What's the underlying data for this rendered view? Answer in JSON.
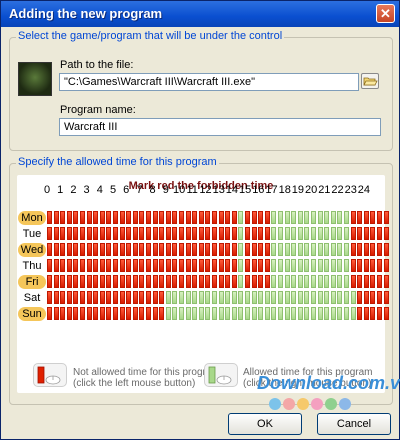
{
  "window": {
    "title": "Adding the new program",
    "close_glyph": "✕"
  },
  "group1": {
    "label": "Select the game/program that will be under the control",
    "path_label": "Path to the file:",
    "path_value": "\"C:\\Games\\Warcraft III\\Warcraft III.exe\"",
    "name_label": "Program name:",
    "name_value": "Warcraft III"
  },
  "group2": {
    "label": "Specify the allowed time for this program"
  },
  "grid": {
    "title": "Mark red the forbidden time",
    "hours": [
      "0",
      "1",
      "2",
      "3",
      "4",
      "5",
      "6",
      "7",
      "8",
      "9",
      "10",
      "11",
      "12",
      "13",
      "14",
      "15",
      "16",
      "17",
      "18",
      "19",
      "20",
      "21",
      "22",
      "23",
      "24"
    ],
    "days": [
      "Mon",
      "Tue",
      "Wed",
      "Thu",
      "Fri",
      "Sat",
      "Sun"
    ],
    "highlighted_days": [
      "Mon",
      "Wed",
      "Fri",
      "Sun"
    ],
    "schedule": [
      "RRRRRRRRRRRRRRRRRRRRRRRRRRRRRGRRRRGGGGGGGGGGGGRRRRRR",
      "RRRRRRRRRRRRRRRRRRRRRRRRRRRRRGRRRRGGGGGGGGGGGGRRRRRR",
      "RRRRRRRRRRRRRRRRRRRRRRRRRRRRRGRRRRGGGGGGGGGGGGRRRRRR",
      "RRRRRRRRRRRRRRRRRRRRRRRRRRRRRGRRRRGGGGGGGGGGGGRRRRRR",
      "RRRRRRRRRRRRRRRRRRRRRRRRRRRRRGRRRRGGGGGGGGGGGGRRRRRR",
      "RRRRRRRRRRRRRRRRRRGGGGGGGGGGGGGGGGGGGGGGGGGGGGGRRRRR",
      "RRRRRRRRRRRRRRRRRRGGGGGGGGGGGGGGGGGGGGGGGGGGGGGRRRRR"
    ],
    "colors": {
      "forbidden": "#e02000",
      "allowed": "#a8d88a",
      "day_highlight": "#f5c65a"
    }
  },
  "legend": {
    "forbidden_line1": "Not allowed time for this program",
    "forbidden_line2": "(click the left mouse button)",
    "allowed_line1": "Allowed time for this program",
    "allowed_line2": "(click the right mouse button)",
    "forbidden_icon": "mouse-left-icon",
    "allowed_icon": "mouse-right-icon"
  },
  "watermark": {
    "text": "Download.com.vn"
  },
  "buttons": {
    "ok": "OK",
    "cancel": "Cancel"
  }
}
